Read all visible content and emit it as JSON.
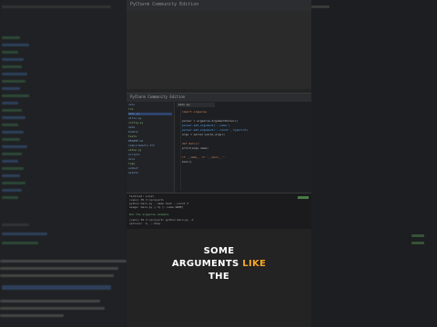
{
  "ide": {
    "window_title": "PyCharm Community Edition",
    "editor_tab": "main.py",
    "tree_items": [
      "venv",
      "lib",
      "main.py",
      "utils.py",
      "config.py",
      "data",
      "models",
      "tests",
      "README.md",
      "requirements.txt",
      "setup.py",
      "scripts",
      "docs",
      "logs",
      "output",
      "assets"
    ],
    "selected_tree_index": 2,
    "code_lines": [
      "import argparse",
      "",
      "parser = argparse.ArgumentParser()",
      "parser.add_argument('--name')",
      "parser.add_argument('--count', type=int)",
      "args = parser.parse_args()",
      "",
      "def main():",
      "    print(args.name)",
      "",
      "if __name__ == '__main__':",
      "    main()"
    ],
    "terminal_lines": [
      "Terminal: Local",
      "(venv) PS C:\\project>",
      "python main.py --name test --count 3",
      "usage: main.py [-h] [--name NAME]",
      "",
      "Run the argparse example",
      "(venv) PS C:\\project> python main.py -h",
      "options: -h, --help"
    ]
  },
  "caption": {
    "line1": "SOME",
    "line2_a": "ARGUMENTS",
    "line2_b": "LIKE",
    "line3": "THE"
  },
  "colors": {
    "caption_text": "#ffffff",
    "caption_highlight": "#f5a623",
    "editor_bg": "#1e1f22"
  }
}
